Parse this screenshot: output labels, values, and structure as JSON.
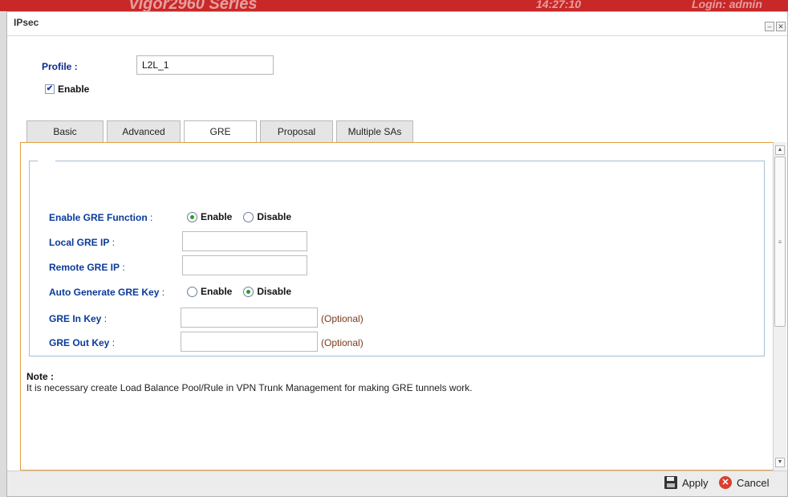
{
  "background": {
    "ghost_title": "Vigor2960 Series",
    "ghost_right_1": "14:27:10",
    "ghost_right_2": "Login: admin"
  },
  "window": {
    "title": "IPsec",
    "minimize_glyph": "–",
    "close_glyph": "✕"
  },
  "profile": {
    "label": "Profile :",
    "value": "L2L_1",
    "enable_label": "Enable",
    "enable_checked": true
  },
  "tabs": [
    {
      "label": "Basic",
      "active": false
    },
    {
      "label": "Advanced",
      "active": false
    },
    {
      "label": "GRE",
      "active": true
    },
    {
      "label": "Proposal",
      "active": false
    },
    {
      "label": "Multiple SAs",
      "active": false
    }
  ],
  "gre": {
    "enable_function": {
      "label": "Enable GRE Function",
      "colon": " :",
      "options": [
        "Enable",
        "Disable"
      ],
      "selected": "Enable"
    },
    "local_ip": {
      "label": "Local GRE IP",
      "colon": " :",
      "value": ""
    },
    "remote_ip": {
      "label": "Remote GRE IP",
      "colon": " :",
      "value": ""
    },
    "auto_key": {
      "label": "Auto Generate GRE Key",
      "colon": " :",
      "options": [
        "Enable",
        "Disable"
      ],
      "selected": "Disable"
    },
    "in_key": {
      "label": "GRE In Key",
      "colon": " :",
      "value": "",
      "hint": "(Optional)"
    },
    "out_key": {
      "label": "GRE Out Key",
      "colon": " :",
      "value": "",
      "hint": "(Optional)"
    }
  },
  "note": {
    "title": "Note :",
    "text": "It is necessary create Load Balance Pool/Rule in VPN Trunk Management for making GRE tunnels work."
  },
  "footer": {
    "apply_label": "Apply",
    "cancel_label": "Cancel"
  },
  "colors": {
    "accent_red": "#c82828",
    "label_blue": "#0a3a9a",
    "panel_border": "#e0a040",
    "radio_selected": "#2a9a2a",
    "optional_hint": "#7a3a1a"
  }
}
